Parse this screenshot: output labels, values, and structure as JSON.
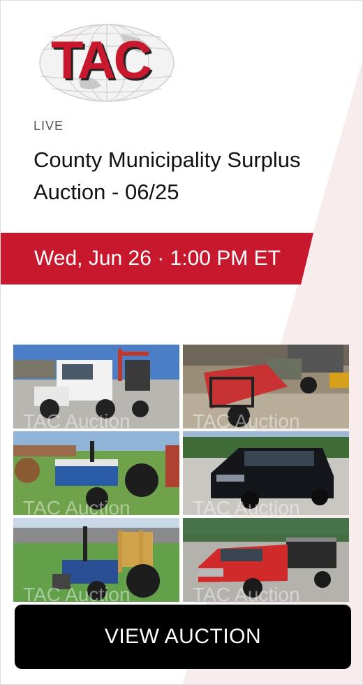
{
  "logo": {
    "text": "TAC",
    "icon": "globe-logo-icon",
    "brand_red": "#c8182e"
  },
  "auction": {
    "status": "LIVE",
    "title": "County Municipality Surplus Auction - 06/25",
    "date": "Wed, Jun 26 · 1:00 PM ET"
  },
  "gallery": {
    "watermark": "TAC Auction",
    "items": [
      {
        "subject": "white-boom-truck"
      },
      {
        "subject": "red-utility-vehicle"
      },
      {
        "subject": "blue-tractor"
      },
      {
        "subject": "black-suv"
      },
      {
        "subject": "blue-tractor-loader"
      },
      {
        "subject": "red-flatbed-truck"
      }
    ]
  },
  "actions": {
    "view_label": "VIEW AUCTION"
  },
  "colors": {
    "accent": "#c8182e",
    "button": "#000000",
    "background_wedge": "#f8ecec"
  }
}
